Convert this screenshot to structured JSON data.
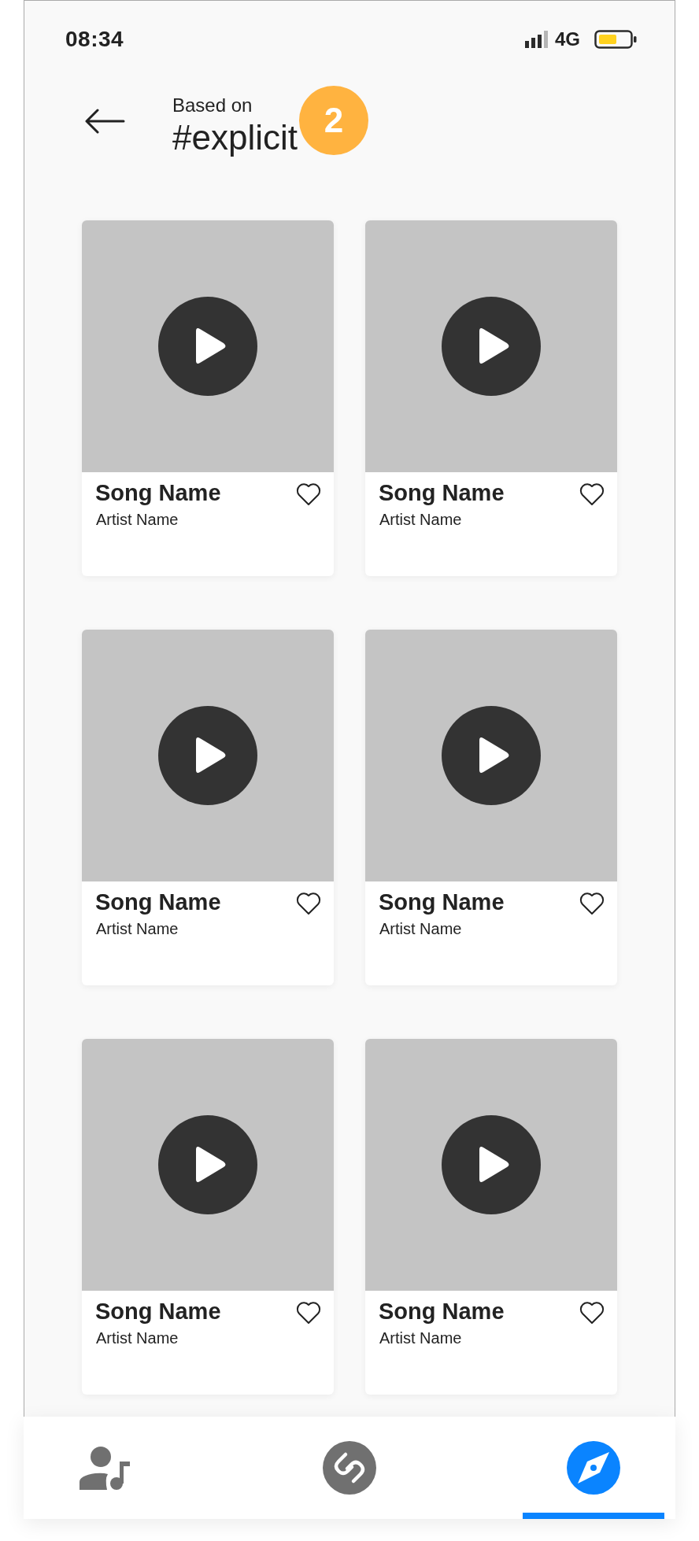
{
  "status_bar": {
    "time": "08:34",
    "network": "4G"
  },
  "header": {
    "subtitle": "Based on",
    "title": "#explicit",
    "badge": "2"
  },
  "songs": [
    {
      "title": "Song Name",
      "artist": "Artist Name",
      "liked": false
    },
    {
      "title": "Song Name",
      "artist": "Artist Name",
      "liked": false
    },
    {
      "title": "Song Name",
      "artist": "Artist Name",
      "liked": false
    },
    {
      "title": "Song Name",
      "artist": "Artist Name",
      "liked": false
    },
    {
      "title": "Song Name",
      "artist": "Artist Name",
      "liked": false
    },
    {
      "title": "Song Name",
      "artist": "Artist Name",
      "liked": false
    }
  ],
  "bottom_nav": [
    {
      "kind": "profile",
      "selected": false
    },
    {
      "kind": "shazam",
      "selected": false
    },
    {
      "kind": "compass",
      "selected": true
    }
  ]
}
